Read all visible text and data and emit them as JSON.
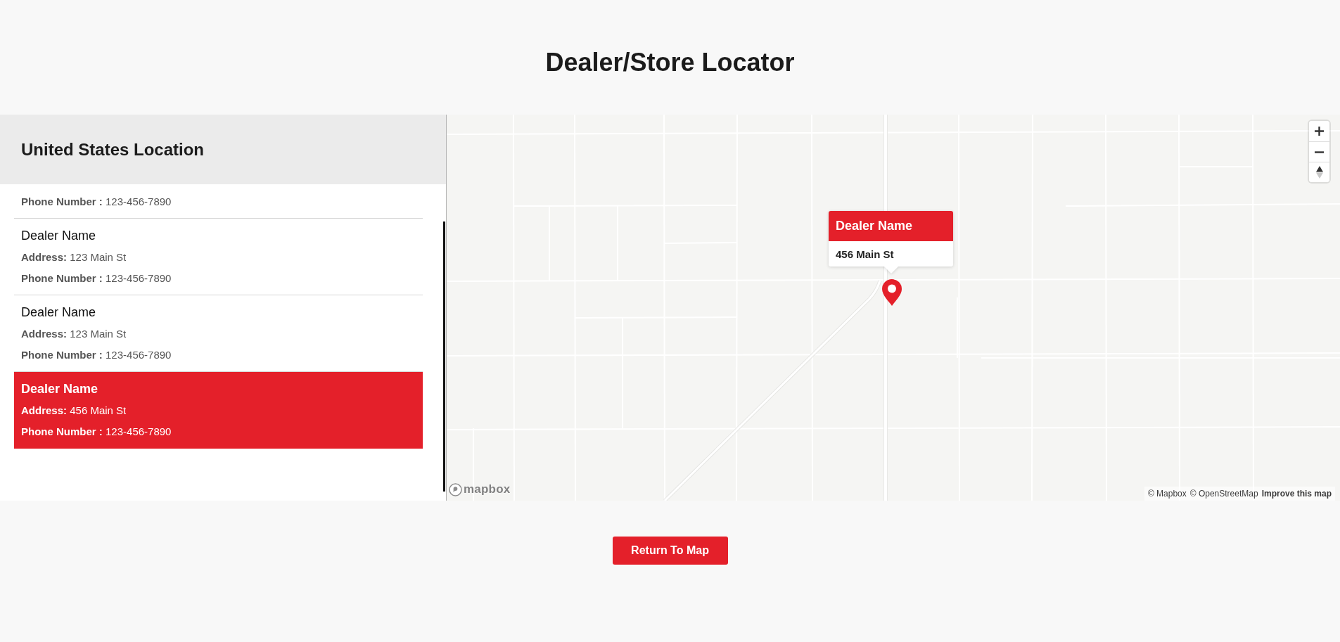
{
  "page": {
    "title": "Dealer/Store Locator"
  },
  "sidebar": {
    "title": "United States Location",
    "dealers": [
      {
        "phone": "**Phone Number :** 123-456-7890",
        "selected": false
      },
      {
        "name": "Dealer Name",
        "address": "**Address:** 123 Main St",
        "phone": "**Phone Number :** 123-456-7890",
        "selected": false
      },
      {
        "name": "Dealer Name",
        "address": "**Address:** 123 Main St",
        "phone": "**Phone Number :** 123-456-7890",
        "selected": false
      },
      {
        "name": "Dealer Name",
        "address": "**Address:** 456 Main St",
        "phone": "**Phone Number :** 123-456-7890",
        "selected": true
      }
    ]
  },
  "map": {
    "popup": {
      "title": "Dealer Name",
      "address": "456 Main St"
    },
    "logo": "mapbox",
    "attribution": [
      {
        "text": "© Mapbox",
        "kind": "credit"
      },
      {
        "text": "© OpenStreetMap",
        "kind": "credit"
      },
      {
        "text": "Improve this map",
        "kind": "feedback"
      }
    ]
  },
  "return_button": "Return To Map"
}
